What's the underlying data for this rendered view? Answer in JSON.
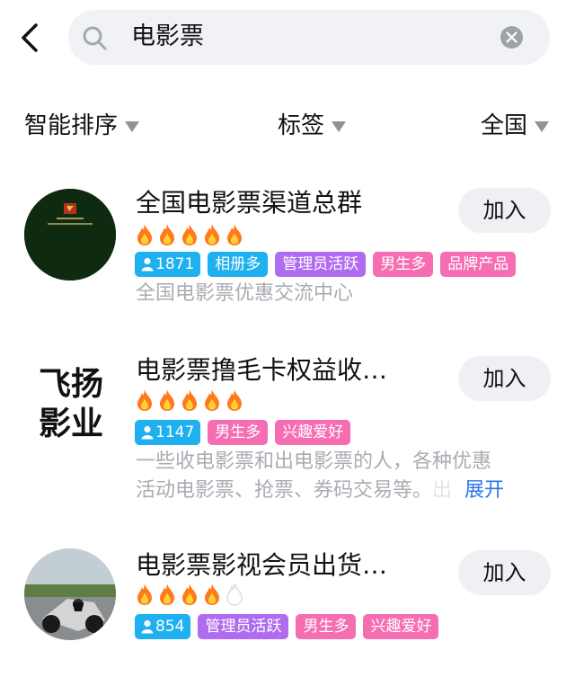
{
  "search": {
    "query": "电影票",
    "icon": "search-icon",
    "clear_icon": "clear-icon"
  },
  "filters": [
    {
      "label": "智能排序",
      "icon": "dropdown-triangle-icon"
    },
    {
      "label": "标签",
      "icon": "dropdown-triangle-icon"
    },
    {
      "label": "全国",
      "icon": "dropdown-triangle-icon"
    }
  ],
  "colors": {
    "count_tag": "#1fb0f0",
    "tag_purple": "#b06cf0",
    "tag_pink": "#f56eb2",
    "flame_active": "#ff7a1a",
    "link": "#2a77ea"
  },
  "results": [
    {
      "title": "全国电影票渠道总群",
      "flame_rating": 5,
      "flame_max": 5,
      "member_count": "1871",
      "tags": [
        "相册多",
        "管理员活跃",
        "男生多",
        "品牌产品"
      ],
      "description": "全国电影票优惠交流中心",
      "join_label": "加入"
    },
    {
      "title": "电影票撸毛卡权益收…",
      "avatar_text_line1": "飞扬",
      "avatar_text_line2": "影业",
      "flame_rating": 5,
      "flame_max": 5,
      "member_count": "1147",
      "tags": [
        "男生多",
        "兴趣爱好"
      ],
      "description_line1": "一些收电影票和出电影票的人，各种优惠",
      "description_line2": "活动电影票、抢票、券码交易等。",
      "description_fade": "出",
      "expand_label": "展开",
      "join_label": "加入"
    },
    {
      "title": "电影票影视会员出货…",
      "flame_rating": 4,
      "flame_max": 5,
      "member_count": "854",
      "tags": [
        "管理员活跃",
        "男生多",
        "兴趣爱好"
      ],
      "join_label": "加入"
    }
  ]
}
